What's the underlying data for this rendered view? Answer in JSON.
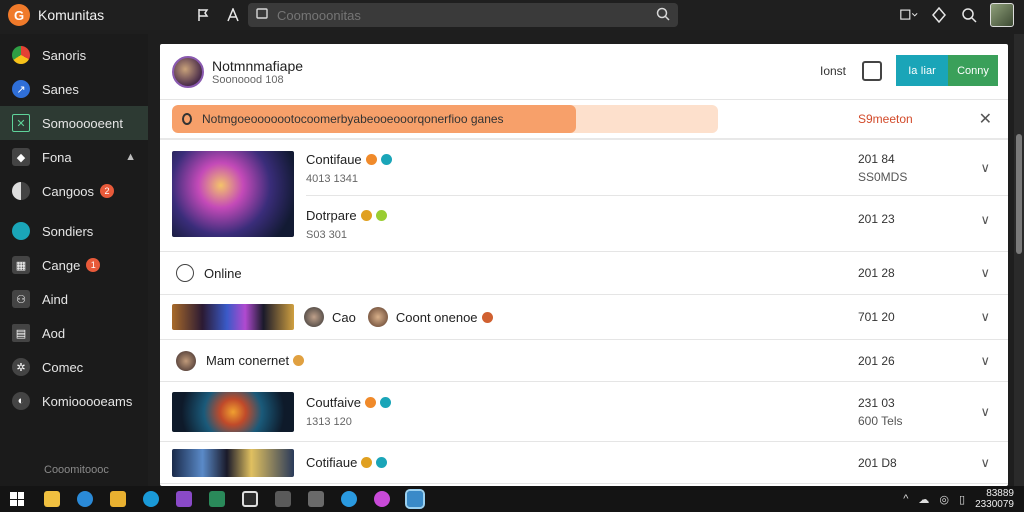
{
  "app": {
    "title": "Komunitas",
    "logo_glyph": "G"
  },
  "search": {
    "placeholder": "Coomooonitas"
  },
  "sidebar": {
    "items": [
      {
        "label": "Sanoris",
        "icon": "chrome-icon",
        "color": "#e34234"
      },
      {
        "label": "Sanes",
        "icon": "compass-icon",
        "color": "#2f6fd8"
      },
      {
        "label": "Somooooeent",
        "icon": "chart-icon",
        "color": "#2f8f6a"
      },
      {
        "label": "Fona",
        "icon": "game-icon",
        "color": "#555555"
      },
      {
        "label": "Cangoos",
        "icon": "half-circle-icon",
        "color": "#666666",
        "badge": "2"
      },
      {
        "label": "Sondiers",
        "icon": "globe-icon",
        "color": "#1aa5b8"
      },
      {
        "label": "Cange",
        "icon": "store-icon",
        "color": "#555555",
        "badge": "1"
      },
      {
        "label": "Aind",
        "icon": "people-icon",
        "color": "#555555"
      },
      {
        "label": "Aod",
        "icon": "doc-icon",
        "color": "#555555"
      },
      {
        "label": "Comec",
        "icon": "settings-icon",
        "color": "#555555"
      },
      {
        "label": "Komiooooeams",
        "icon": "info-icon",
        "color": "#555555"
      }
    ],
    "footer": "Cooomitoooc"
  },
  "header": {
    "name": "Notmnmafiape",
    "sub": "Soonoood 108",
    "link": "Ionst",
    "btn_primary": "Ia Iiar",
    "btn_secondary": "Conny"
  },
  "alert": {
    "text": "Notmgoeooooootocoomerbyabeooeooorqonerfioo ganes",
    "progress": 0.74,
    "action": "S9meeton",
    "close": "✕"
  },
  "feed": [
    {
      "title": "Contifaue",
      "sub": "4013 1341",
      "date": "201 84",
      "date_sub": "SS0MDS"
    },
    {
      "title": "Dotrpare",
      "sub": "S03 301",
      "date": "201 23",
      "date_sub": ""
    },
    {
      "title": "Online",
      "sub": "",
      "date": "201 28",
      "date_sub": ""
    },
    {
      "title": "Cao",
      "title2": "Coont onenoe",
      "sub": "",
      "date": "701 20",
      "date_sub": ""
    },
    {
      "title": "Mam conernet",
      "sub": "",
      "date": "201 26",
      "date_sub": ""
    },
    {
      "title": "Coutfaive",
      "sub": "1313 120",
      "date": "231 03",
      "date_sub": "600 Tels"
    },
    {
      "title": "Cotifiaue",
      "sub": "",
      "date": "201 D8",
      "date_sub": ""
    }
  ],
  "taskbar": {
    "time": "83889",
    "date": "2330079"
  }
}
